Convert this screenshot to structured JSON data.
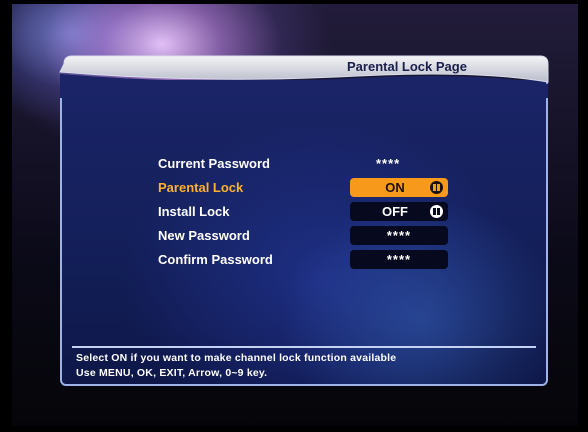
{
  "header": {
    "title": "Parental Lock Page"
  },
  "form": {
    "rows": [
      {
        "label": "Current Password",
        "value": "****"
      },
      {
        "label": "Parental Lock",
        "value": "ON"
      },
      {
        "label": "Install Lock",
        "value": "OFF"
      },
      {
        "label": "New Password",
        "value": "****"
      },
      {
        "label": "Confirm Password",
        "value": "****"
      }
    ],
    "selected_row": "Parental Lock"
  },
  "help": {
    "line1": "Select ON if you want to make channel lock function available",
    "line2": "Use MENU, OK, EXIT, Arrow, 0~9 key."
  },
  "colors": {
    "highlight": "#f79a1c",
    "selected_label": "#ffb02c",
    "panel": "#1a2467",
    "header_text": "#1a1f4a"
  },
  "icons": {
    "toggle": "toggle-icon"
  }
}
